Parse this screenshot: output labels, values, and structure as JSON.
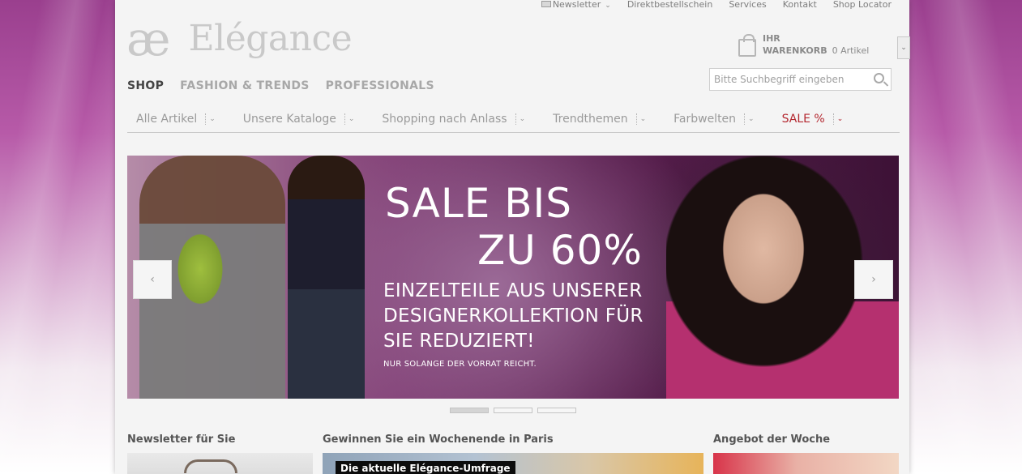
{
  "topnav": {
    "newsletter": "Newsletter",
    "direktbestellschein": "Direktbestellschein",
    "services": "Services",
    "kontakt": "Kontakt",
    "shop_locator": "Shop Locator"
  },
  "logo": {
    "mark": "æ",
    "name": "Elégance"
  },
  "cart": {
    "line1": "IHR",
    "line2": "WARENKORB",
    "count": "0 Artikel",
    "dropdown_glyph": "⌄"
  },
  "search": {
    "placeholder": "Bitte Suchbegriff eingeben"
  },
  "sections": [
    {
      "label": "SHOP"
    },
    {
      "label": "FASHION & TRENDS"
    },
    {
      "label": "PROFESSIONALS"
    }
  ],
  "categories": [
    {
      "label": "Alle Artikel"
    },
    {
      "label": "Unsere Kataloge"
    },
    {
      "label": "Shopping nach Anlass"
    },
    {
      "label": "Trendthemen"
    },
    {
      "label": "Farbwelten"
    },
    {
      "label": "SALE %"
    }
  ],
  "hero": {
    "title_line1": "SALE BIS",
    "title_line2": "ZU 60%",
    "subtitle": "EINZELTEILE AUS UNSERER DESIGNERKOLLEKTION FÜR SIE REDUZIERT!",
    "note": "NUR SOLANGE DER VORRAT REICHT.",
    "prev_glyph": "‹",
    "next_glyph": "›",
    "slides_total": 3,
    "active_slide": 1
  },
  "teasers": [
    {
      "title": "Newsletter für Sie"
    },
    {
      "title": "Gewinnen Sie ein Wochenende in Paris",
      "image_label": "Die aktuelle Elégance-Umfrage"
    },
    {
      "title": "Angebot der Woche"
    }
  ],
  "colors": {
    "background_accent": "#9a3f8e",
    "sale_red": "#b3262e",
    "page_bg": "#f4f4f4"
  }
}
